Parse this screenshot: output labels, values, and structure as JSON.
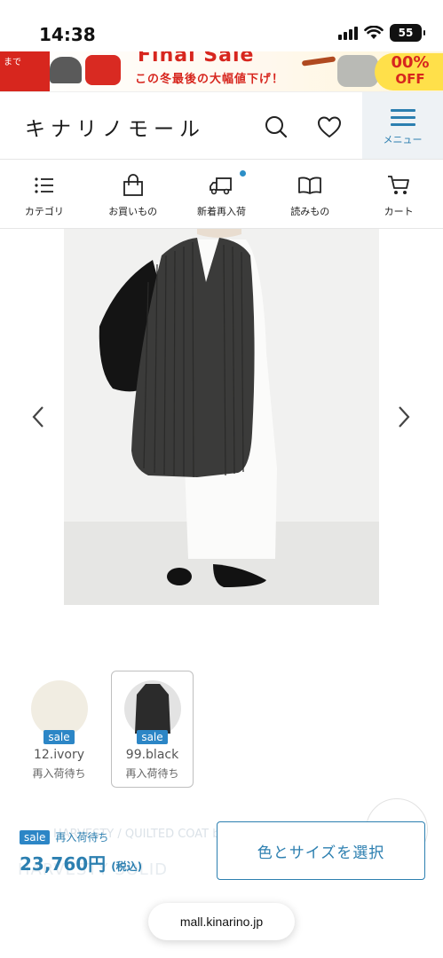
{
  "status_bar": {
    "time": "14:38",
    "battery": "55"
  },
  "banner": {
    "left_text": "まで",
    "title": "Final Sale",
    "subtitle": "この冬最後の大幅値下げ！",
    "discount_pct": "00%",
    "discount_off": "OFF"
  },
  "header": {
    "logo": "キナリノモール",
    "menu_label": "メニュー",
    "search_icon": "search-icon",
    "favorite_icon": "heart-icon"
  },
  "nav": {
    "items": [
      {
        "label": "カテゴリ",
        "icon": "list-icon"
      },
      {
        "label": "お買いもの",
        "icon": "shopping-bag-icon"
      },
      {
        "label": "新着再入荷",
        "icon": "delivery-truck-icon",
        "has_dot": true
      },
      {
        "label": "読みもの",
        "icon": "book-icon"
      },
      {
        "label": "カート",
        "icon": "cart-icon"
      }
    ]
  },
  "product": {
    "image_alt": "black quilted long vest over white dress",
    "variants": [
      {
        "badge": "sale",
        "name": "12.ivory",
        "status": "再入荷待ち",
        "color": "#f1ede2",
        "selected": false
      },
      {
        "badge": "sale",
        "name": "99.black",
        "status": "再入荷待ち",
        "color": "#2b2b2b",
        "selected": true
      }
    ]
  },
  "purchase": {
    "badge": "sale",
    "status": "再入荷待ち",
    "price": "23,760円",
    "tax": "(税込)",
    "select_label": "色とサイズを選択",
    "ghost_title": "HARVESTY / QUILTED COAT by woody",
    "ghost_brand": "HARVESTY SOLID"
  },
  "browser": {
    "url": "mall.kinarino.jp"
  },
  "colors": {
    "accent": "#2c7fb0",
    "sale": "#2c86c6",
    "banner_red": "#d7261e"
  }
}
